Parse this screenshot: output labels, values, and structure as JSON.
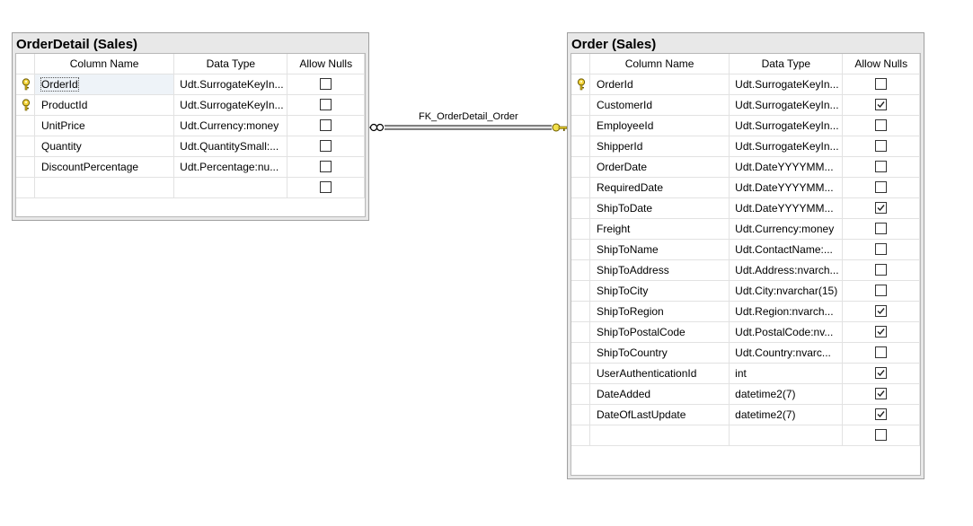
{
  "columns_header": {
    "name": "Column Name",
    "type": "Data Type",
    "nulls": "Allow Nulls"
  },
  "relationship": {
    "label": "FK_OrderDetail_Order"
  },
  "order_detail": {
    "title": "OrderDetail (Sales)",
    "rows": [
      {
        "name": "OrderId",
        "type": "Udt.SurrogateKeyIn...",
        "pk": true,
        "nullable": false,
        "selected": true
      },
      {
        "name": "ProductId",
        "type": "Udt.SurrogateKeyIn...",
        "pk": true,
        "nullable": false
      },
      {
        "name": "UnitPrice",
        "type": "Udt.Currency:money",
        "pk": false,
        "nullable": false
      },
      {
        "name": "Quantity",
        "type": "Udt.QuantitySmall:...",
        "pk": false,
        "nullable": false
      },
      {
        "name": "DiscountPercentage",
        "type": "Udt.Percentage:nu...",
        "pk": false,
        "nullable": false
      },
      {
        "name": "",
        "type": "",
        "pk": false,
        "nullable": false
      }
    ]
  },
  "order": {
    "title": "Order (Sales)",
    "rows": [
      {
        "name": "OrderId",
        "type": "Udt.SurrogateKeyIn...",
        "pk": true,
        "nullable": false
      },
      {
        "name": "CustomerId",
        "type": "Udt.SurrogateKeyIn...",
        "pk": false,
        "nullable": true
      },
      {
        "name": "EmployeeId",
        "type": "Udt.SurrogateKeyIn...",
        "pk": false,
        "nullable": false
      },
      {
        "name": "ShipperId",
        "type": "Udt.SurrogateKeyIn...",
        "pk": false,
        "nullable": false
      },
      {
        "name": "OrderDate",
        "type": "Udt.DateYYYYMM...",
        "pk": false,
        "nullable": false
      },
      {
        "name": "RequiredDate",
        "type": "Udt.DateYYYYMM...",
        "pk": false,
        "nullable": false
      },
      {
        "name": "ShipToDate",
        "type": "Udt.DateYYYYMM...",
        "pk": false,
        "nullable": true
      },
      {
        "name": "Freight",
        "type": "Udt.Currency:money",
        "pk": false,
        "nullable": false
      },
      {
        "name": "ShipToName",
        "type": "Udt.ContactName:...",
        "pk": false,
        "nullable": false
      },
      {
        "name": "ShipToAddress",
        "type": "Udt.Address:nvarch...",
        "pk": false,
        "nullable": false
      },
      {
        "name": "ShipToCity",
        "type": "Udt.City:nvarchar(15)",
        "pk": false,
        "nullable": false
      },
      {
        "name": "ShipToRegion",
        "type": "Udt.Region:nvarch...",
        "pk": false,
        "nullable": true
      },
      {
        "name": "ShipToPostalCode",
        "type": "Udt.PostalCode:nv...",
        "pk": false,
        "nullable": true
      },
      {
        "name": "ShipToCountry",
        "type": "Udt.Country:nvarc...",
        "pk": false,
        "nullable": false
      },
      {
        "name": "UserAuthenticationId",
        "type": "int",
        "pk": false,
        "nullable": true
      },
      {
        "name": "DateAdded",
        "type": "datetime2(7)",
        "pk": false,
        "nullable": true
      },
      {
        "name": "DateOfLastUpdate",
        "type": "datetime2(7)",
        "pk": false,
        "nullable": true
      },
      {
        "name": "",
        "type": "",
        "pk": false,
        "nullable": false
      }
    ]
  }
}
